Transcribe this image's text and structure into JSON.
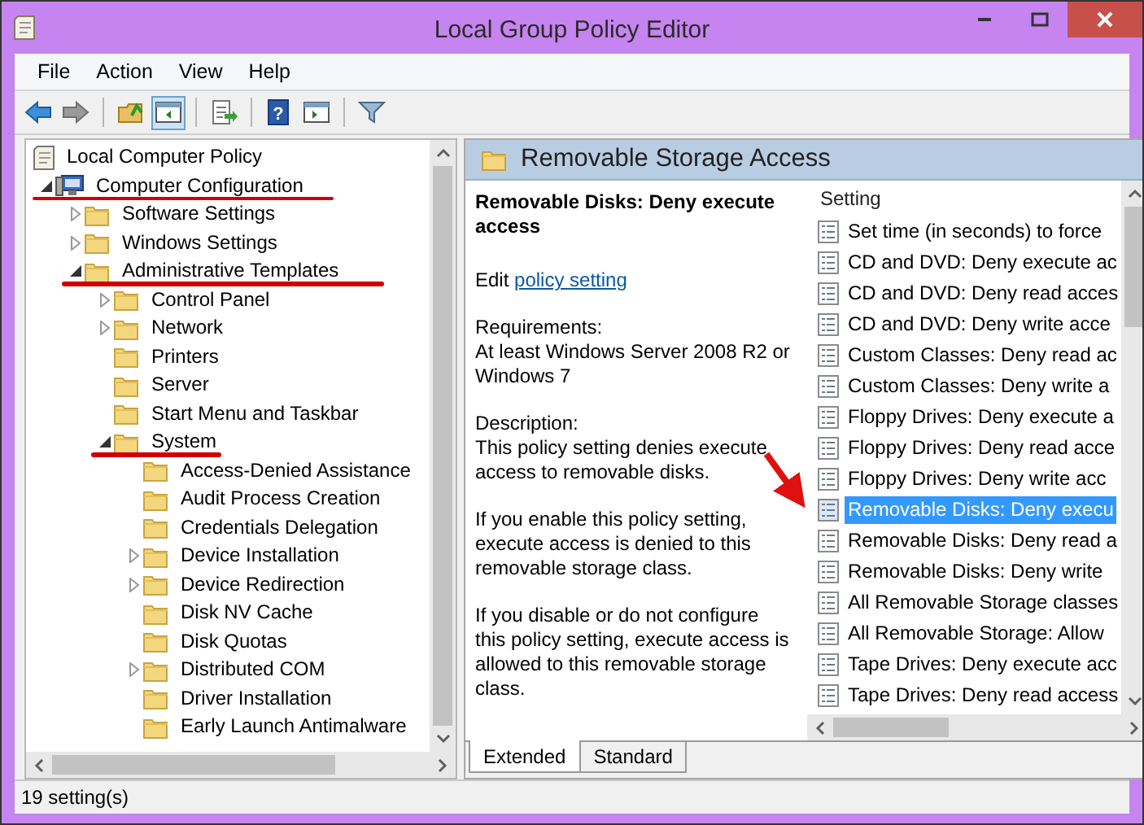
{
  "window": {
    "title": "Local Group Policy Editor"
  },
  "menu": [
    "File",
    "Action",
    "View",
    "Help"
  ],
  "toolbar": [
    {
      "kind": "back",
      "pressed": false
    },
    {
      "kind": "forward",
      "pressed": false
    },
    {
      "kind": "sep"
    },
    {
      "kind": "folder-up",
      "pressed": false
    },
    {
      "kind": "tree-toggle",
      "pressed": true
    },
    {
      "kind": "sep"
    },
    {
      "kind": "export",
      "pressed": false
    },
    {
      "kind": "sep"
    },
    {
      "kind": "help",
      "glyph": "?",
      "pressed": false
    },
    {
      "kind": "view",
      "pressed": false
    },
    {
      "kind": "sep"
    },
    {
      "kind": "filter",
      "pressed": false
    }
  ],
  "tree": [
    {
      "label": "Local Computer Policy",
      "kind": "root",
      "marked": false,
      "children": [
        {
          "label": "Computer Configuration",
          "kind": "computer",
          "expanded": true,
          "marked": true,
          "children": [
            {
              "label": "Software Settings",
              "kind": "folder",
              "expanded": false,
              "marked": false
            },
            {
              "label": "Windows Settings",
              "kind": "folder",
              "expanded": false,
              "marked": false
            },
            {
              "label": "Administrative Templates",
              "kind": "folder",
              "expanded": true,
              "marked": true,
              "children": [
                {
                  "label": "Control Panel",
                  "kind": "folder",
                  "expanded": false,
                  "marked": false
                },
                {
                  "label": "Network",
                  "kind": "folder",
                  "expanded": false,
                  "marked": false
                },
                {
                  "label": "Printers",
                  "kind": "folder",
                  "marked": false
                },
                {
                  "label": "Server",
                  "kind": "folder",
                  "marked": false
                },
                {
                  "label": "Start Menu and Taskbar",
                  "kind": "folder",
                  "marked": false
                },
                {
                  "label": "System",
                  "kind": "folder",
                  "expanded": true,
                  "marked": true,
                  "children": [
                    {
                      "label": "Access-Denied Assistance",
                      "kind": "folder",
                      "marked": false
                    },
                    {
                      "label": "Audit Process Creation",
                      "kind": "folder",
                      "marked": false
                    },
                    {
                      "label": "Credentials Delegation",
                      "kind": "folder",
                      "marked": false
                    },
                    {
                      "label": "Device Installation",
                      "kind": "folder",
                      "expanded": false,
                      "marked": false
                    },
                    {
                      "label": "Device Redirection",
                      "kind": "folder",
                      "expanded": false,
                      "marked": false
                    },
                    {
                      "label": "Disk NV Cache",
                      "kind": "folder",
                      "marked": false
                    },
                    {
                      "label": "Disk Quotas",
                      "kind": "folder",
                      "marked": false
                    },
                    {
                      "label": "Distributed COM",
                      "kind": "folder",
                      "expanded": false,
                      "marked": false
                    },
                    {
                      "label": "Driver Installation",
                      "kind": "folder",
                      "marked": false
                    },
                    {
                      "label": "Early Launch Antimalware",
                      "kind": "folder",
                      "marked": false
                    }
                  ]
                }
              ]
            }
          ]
        }
      ]
    }
  ],
  "details": {
    "header": "Removable Storage Access",
    "title": "Removable Disks: Deny execute access",
    "edit_prefix": "Edit",
    "edit_link": "policy setting",
    "requirements_label": "Requirements:",
    "requirements": "At least Windows Server 2008 R2 or Windows 7",
    "description_label": "Description:",
    "description": "This policy setting denies execute access to removable disks.",
    "paragraphs": [
      "If you enable this policy setting, execute access is denied to this removable storage class.",
      "If you disable or do not configure this policy setting, execute access is allowed to this removable storage class."
    ]
  },
  "settings": {
    "column": "Setting",
    "rows": [
      {
        "label": "Set time (in seconds) to force",
        "selected": false
      },
      {
        "label": "CD and DVD: Deny execute ac",
        "selected": false
      },
      {
        "label": "CD and DVD: Deny read acces",
        "selected": false
      },
      {
        "label": "CD and DVD: Deny write acce",
        "selected": false
      },
      {
        "label": "Custom Classes: Deny read ac",
        "selected": false
      },
      {
        "label": "Custom Classes: Deny write a",
        "selected": false
      },
      {
        "label": "Floppy Drives: Deny execute a",
        "selected": false
      },
      {
        "label": "Floppy Drives: Deny read acce",
        "selected": false
      },
      {
        "label": "Floppy Drives: Deny write acc",
        "selected": false
      },
      {
        "label": "Removable Disks: Deny execu",
        "selected": true
      },
      {
        "label": "Removable Disks: Deny read a",
        "selected": false
      },
      {
        "label": "Removable Disks: Deny write",
        "selected": false
      },
      {
        "label": "All Removable Storage classes",
        "selected": false
      },
      {
        "label": "All Removable Storage: Allow",
        "selected": false
      },
      {
        "label": "Tape Drives: Deny execute acc",
        "selected": false
      },
      {
        "label": "Tape Drives: Deny read access",
        "selected": false
      }
    ],
    "annotation_arrow": true
  },
  "tabs": [
    {
      "label": "Extended",
      "selected": true
    },
    {
      "label": "Standard",
      "selected": false
    }
  ],
  "status_bar": "19 setting(s)"
}
